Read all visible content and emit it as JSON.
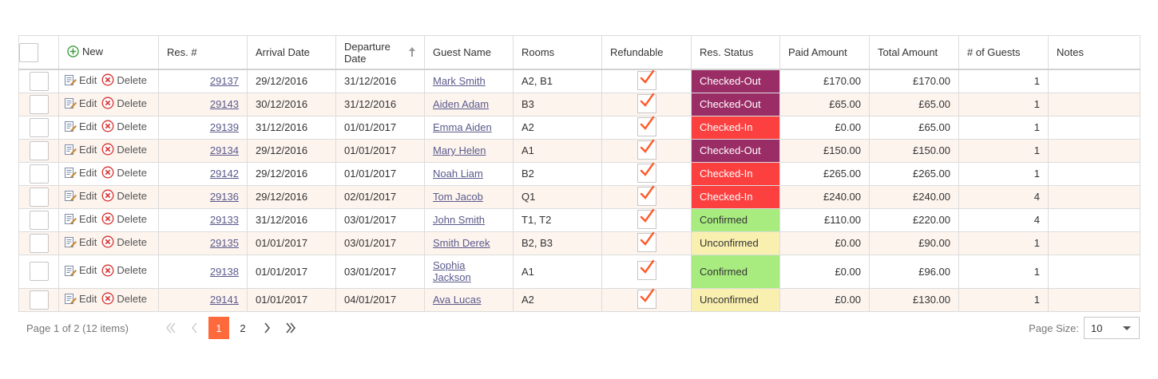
{
  "grid": {
    "new_label": "New",
    "columns": {
      "res_no": "Res. #",
      "arrival": "Arrival Date",
      "departure": "Departure Date",
      "guest": "Guest Name",
      "rooms": "Rooms",
      "refundable": "Refundable",
      "status": "Res. Status",
      "paid": "Paid Amount",
      "total": "Total Amount",
      "guests": "# of Guests",
      "notes": "Notes"
    },
    "edit_label": "Edit",
    "delete_label": "Delete",
    "rows": [
      {
        "res": "29137",
        "arrival": "29/12/2016",
        "departure": "31/12/2016",
        "guest": "Mark Smith",
        "rooms": "A2, B1",
        "refundable": true,
        "status": "Checked-Out",
        "paid": "£170.00",
        "total": "£170.00",
        "guests": "1",
        "notes": ""
      },
      {
        "res": "29143",
        "arrival": "30/12/2016",
        "departure": "31/12/2016",
        "guest": "Aiden Adam",
        "rooms": "B3",
        "refundable": true,
        "status": "Checked-Out",
        "paid": "£65.00",
        "total": "£65.00",
        "guests": "1",
        "notes": ""
      },
      {
        "res": "29139",
        "arrival": "31/12/2016",
        "departure": "01/01/2017",
        "guest": "Emma Aiden",
        "rooms": "A2",
        "refundable": true,
        "status": "Checked-In",
        "paid": "£0.00",
        "total": "£65.00",
        "guests": "1",
        "notes": ""
      },
      {
        "res": "29134",
        "arrival": "29/12/2016",
        "departure": "01/01/2017",
        "guest": "Mary Helen",
        "rooms": "A1",
        "refundable": true,
        "status": "Checked-Out",
        "paid": "£150.00",
        "total": "£150.00",
        "guests": "1",
        "notes": ""
      },
      {
        "res": "29142",
        "arrival": "29/12/2016",
        "departure": "01/01/2017",
        "guest": "Noah Liam",
        "rooms": "B2",
        "refundable": true,
        "status": "Checked-In",
        "paid": "£265.00",
        "total": "£265.00",
        "guests": "1",
        "notes": ""
      },
      {
        "res": "29136",
        "arrival": "29/12/2016",
        "departure": "02/01/2017",
        "guest": "Tom Jacob",
        "rooms": "Q1",
        "refundable": true,
        "status": "Checked-In",
        "paid": "£240.00",
        "total": "£240.00",
        "guests": "4",
        "notes": ""
      },
      {
        "res": "29133",
        "arrival": "31/12/2016",
        "departure": "03/01/2017",
        "guest": "John Smith",
        "rooms": "T1, T2",
        "refundable": true,
        "status": "Confirmed",
        "paid": "£110.00",
        "total": "£220.00",
        "guests": "4",
        "notes": ""
      },
      {
        "res": "29135",
        "arrival": "01/01/2017",
        "departure": "03/01/2017",
        "guest": "Smith Derek",
        "rooms": "B2, B3",
        "refundable": true,
        "status": "Unconfirmed",
        "paid": "£0.00",
        "total": "£90.00",
        "guests": "1",
        "notes": ""
      },
      {
        "res": "29138",
        "arrival": "01/01/2017",
        "departure": "03/01/2017",
        "guest": "Sophia Jackson",
        "rooms": "A1",
        "refundable": true,
        "status": "Confirmed",
        "paid": "£0.00",
        "total": "£96.00",
        "guests": "1",
        "notes": ""
      },
      {
        "res": "29141",
        "arrival": "01/01/2017",
        "departure": "04/01/2017",
        "guest": "Ava Lucas",
        "rooms": "A2",
        "refundable": true,
        "status": "Unconfirmed",
        "paid": "£0.00",
        "total": "£130.00",
        "guests": "1",
        "notes": ""
      }
    ]
  },
  "status_colors": {
    "Checked-Out": "#9b2d66",
    "Checked-In": "#fc4040",
    "Confirmed": "#a8ec80",
    "Unconfirmed": "#f9f0b0"
  },
  "pager": {
    "info": "Page 1 of 2 (12 items)",
    "pages": [
      "1",
      "2"
    ],
    "current_page": "1",
    "page_size_label": "Page Size:",
    "page_size_value": "10"
  },
  "icons": {
    "new": "plus-circle-icon",
    "edit": "edit-icon",
    "delete": "delete-circle-icon",
    "check": "checkmark-icon",
    "sort": "sort-ascending-icon"
  },
  "accent_color": "#ff6a3d"
}
